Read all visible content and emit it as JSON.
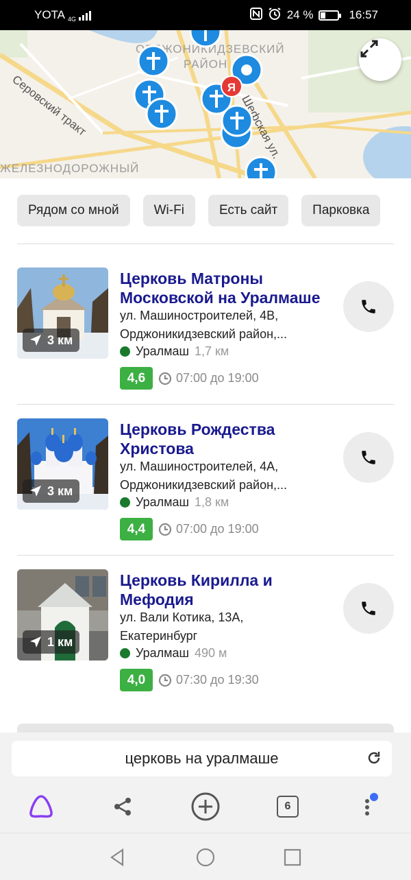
{
  "status_bar": {
    "carrier": "YOTA",
    "network": "4G",
    "battery_percent": "24 %",
    "time": "16:57",
    "icons": [
      "nfc-icon",
      "alarm-icon",
      "battery-icon",
      "signal-icon"
    ]
  },
  "map": {
    "labels": {
      "district_top": "ОРДЖОНИКИДЗЕВСКИЙ",
      "district_top2": "РАЙОН",
      "serovsky": "Серовский тракт",
      "shefskaya": "Шефская ул.",
      "zheleznodorozhny": "ЖЕЛЕЗНОДОРОЖНЫЙ"
    },
    "pin_icon": "church-cross-icon",
    "yandex_marker": "Я",
    "water_color": "#b5d3ec",
    "pin_color": "#1e8be0"
  },
  "filters": [
    {
      "label": "Рядом со мной"
    },
    {
      "label": "Wi-Fi"
    },
    {
      "label": "Есть сайт"
    },
    {
      "label": "Парковка"
    }
  ],
  "results": [
    {
      "title": "Церковь Матроны Московской на Уралмаше",
      "address_line1": "ул. Машиностроителей, 4В,",
      "address_line2": "Орджоникидзевский район,...",
      "metro": "Уралмаш",
      "metro_distance": "1,7 км",
      "distance": "3 км",
      "rating": "4,6",
      "hours": "07:00 до 19:00"
    },
    {
      "title": "Церковь Рождества Христова",
      "address_line1": "ул. Машиностроителей, 4А,",
      "address_line2": "Орджоникидзевский район,...",
      "metro": "Уралмаш",
      "metro_distance": "1,8 км",
      "distance": "3 км",
      "rating": "4,4",
      "hours": "07:00 до 19:00"
    },
    {
      "title": "Церковь Кирилла и Мефодия",
      "address_line1": "ул. Вали Котика, 13А,",
      "address_line2": "Екатеринбург",
      "metro": "Уралмаш",
      "metro_distance": "490 м",
      "distance": "1 км",
      "rating": "4,0",
      "hours": "07:30 до 19:30"
    }
  ],
  "browser": {
    "query": "церковь на уралмаше",
    "tabs_count": "6",
    "alice_color": "#8a3ff0",
    "notification_dot_color": "#3d6cf7"
  },
  "colors": {
    "title_link": "#1a1a8f",
    "rating_green": "#3cb043",
    "metro_green": "#1a7a2c"
  }
}
